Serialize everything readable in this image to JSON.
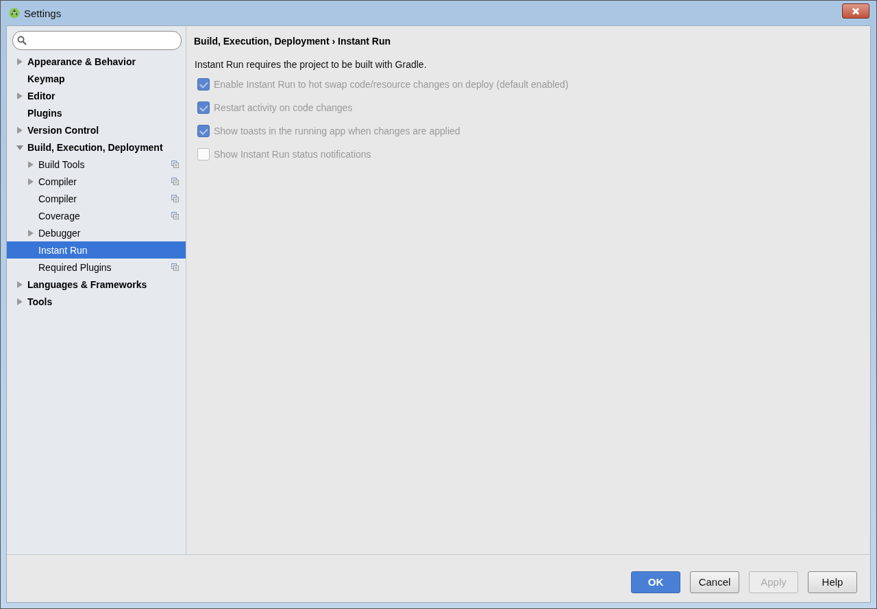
{
  "window": {
    "title": "Settings"
  },
  "sidebar": {
    "items": [
      {
        "label": "Appearance & Behavior",
        "expanded": false,
        "selected": false
      },
      {
        "label": "Keymap",
        "selected": false
      },
      {
        "label": "Editor",
        "expanded": false,
        "selected": false
      },
      {
        "label": "Plugins",
        "selected": false
      },
      {
        "label": "Version Control",
        "expanded": false,
        "selected": false
      },
      {
        "label": "Build, Execution, Deployment",
        "expanded": true,
        "selected": false,
        "children": [
          {
            "label": "Build Tools",
            "expanded": false,
            "selected": false,
            "project_scoped": true
          },
          {
            "label": "Compiler",
            "expanded": false,
            "selected": false,
            "project_scoped": true
          },
          {
            "label": "Compiler",
            "selected": false,
            "project_scoped": true
          },
          {
            "label": "Coverage",
            "selected": false,
            "project_scoped": true
          },
          {
            "label": "Debugger",
            "expanded": false,
            "selected": false
          },
          {
            "label": "Instant Run",
            "selected": true
          },
          {
            "label": "Required Plugins",
            "selected": false,
            "project_scoped": true
          }
        ]
      },
      {
        "label": "Languages & Frameworks",
        "expanded": false,
        "selected": false
      },
      {
        "label": "Tools",
        "expanded": false,
        "selected": false
      }
    ]
  },
  "breadcrumb": "Build, Execution, Deployment › Instant Run",
  "note": "Instant Run requires the project to be built with Gradle.",
  "options": [
    {
      "label": "Enable Instant Run to hot swap code/resource changes on deploy (default enabled)",
      "checked": true,
      "disabled": true
    },
    {
      "label": "Restart activity on code changes",
      "checked": true,
      "disabled": true
    },
    {
      "label": "Show toasts in the running app when changes are applied",
      "checked": true,
      "disabled": true
    },
    {
      "label": "Show Instant Run status notifications",
      "checked": false,
      "disabled": true
    }
  ],
  "buttons": [
    {
      "label": "OK",
      "kind": "primary",
      "disabled": false
    },
    {
      "label": "Cancel",
      "kind": "default",
      "disabled": false
    },
    {
      "label": "Apply",
      "kind": "default",
      "disabled": true
    },
    {
      "label": "Help",
      "kind": "default",
      "disabled": false
    }
  ]
}
